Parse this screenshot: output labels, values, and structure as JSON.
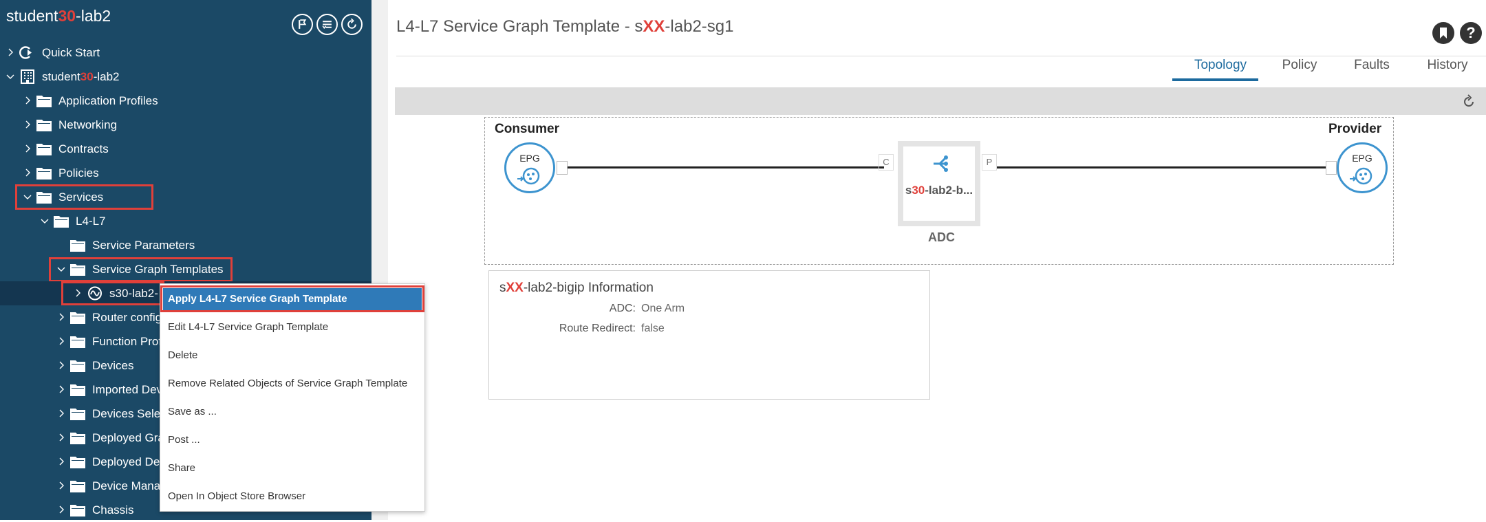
{
  "sidebar": {
    "title_prefix": "student",
    "title_redact": "30",
    "title_suffix": "-lab2",
    "tools": [
      "bookmark-flag-icon",
      "filter-list-icon",
      "refresh-icon"
    ],
    "items": [
      {
        "label": "Quick Start"
      },
      {
        "label_prefix": "student",
        "label_redact": "30",
        "label_suffix": "-lab2"
      },
      {
        "label": "Application Profiles"
      },
      {
        "label": "Networking"
      },
      {
        "label": "Contracts"
      },
      {
        "label": "Policies"
      },
      {
        "label": "Services"
      },
      {
        "label": "L4-L7"
      },
      {
        "label": "Service Parameters"
      },
      {
        "label": "Service Graph Templates"
      },
      {
        "label": "s30-lab2-"
      },
      {
        "label": "Router config"
      },
      {
        "label": "Function Prof"
      },
      {
        "label": "Devices"
      },
      {
        "label": "Imported Dev"
      },
      {
        "label": "Devices Sele"
      },
      {
        "label": "Deployed Gra"
      },
      {
        "label": "Deployed Dev"
      },
      {
        "label": "Device Mana"
      },
      {
        "label": "Chassis"
      }
    ]
  },
  "main": {
    "title_prefix": "L4-L7 Service Graph Template - s",
    "title_redact": "XX",
    "title_suffix": "-lab2-sg1",
    "tabs": [
      {
        "label": "Topology",
        "active": true
      },
      {
        "label": "Policy"
      },
      {
        "label": "Faults"
      },
      {
        "label": "History"
      }
    ],
    "topology": {
      "consumer_label": "Consumer",
      "provider_label": "Provider",
      "epg_label": "EPG",
      "port_c": "C",
      "port_p": "P",
      "node_prefix": "s",
      "node_redact": "30",
      "node_suffix": "-lab2-b...",
      "node_type": "ADC"
    },
    "info": {
      "title_prefix": "s",
      "title_redact": "XX",
      "title_suffix": "-lab2-bigip Information",
      "rows": [
        {
          "key": "ADC:",
          "value": "One Arm"
        },
        {
          "key": "Route Redirect:",
          "value": "false"
        }
      ]
    }
  },
  "context_menu": {
    "items": [
      {
        "label": "Apply L4-L7 Service Graph Template"
      },
      {
        "label": "Edit L4-L7 Service Graph Template"
      },
      {
        "label": "Delete"
      },
      {
        "label": "Remove Related Objects of Service Graph Template"
      },
      {
        "label": "Save as ..."
      },
      {
        "label": "Post ..."
      },
      {
        "label": "Share"
      },
      {
        "label": "Open In Object Store Browser"
      }
    ]
  },
  "colors": {
    "sidebar_bg": "#1b4966",
    "accent": "#1c6a9e",
    "highlight": "#e0403a",
    "menu_active": "#2f7ab8"
  }
}
